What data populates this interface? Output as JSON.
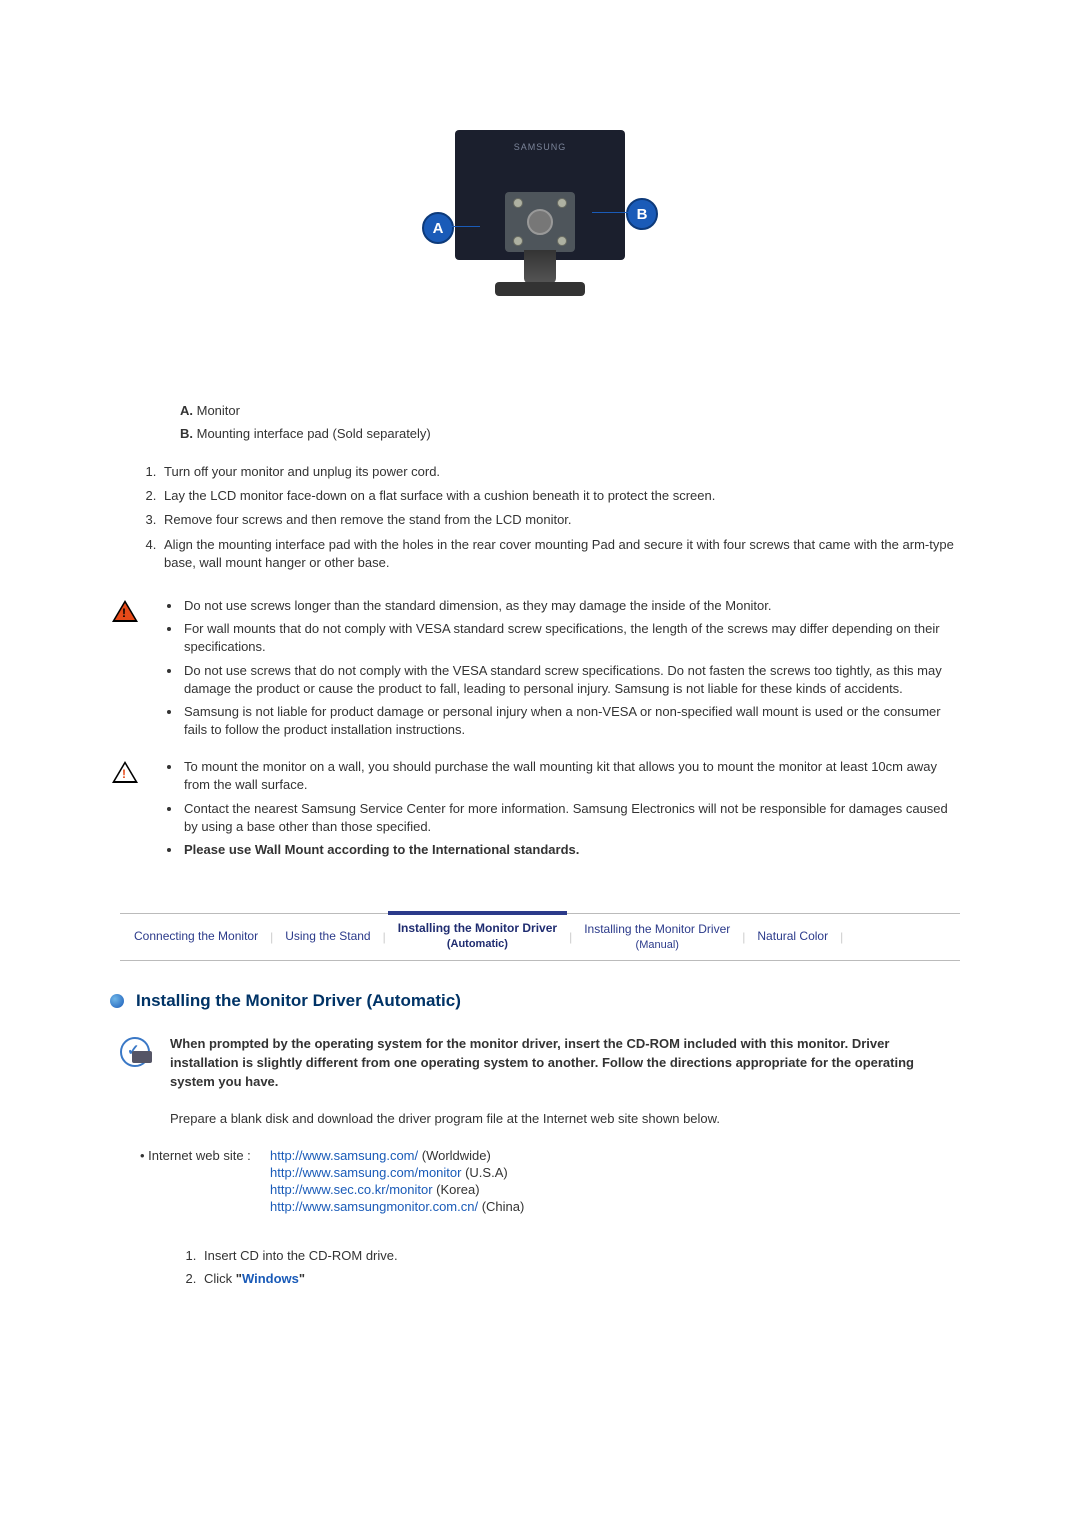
{
  "figure": {
    "markerA": "A",
    "markerB": "B",
    "logo_text": "SAMSUNG"
  },
  "legend": {
    "a_label": "A.",
    "a_text": "Monitor",
    "b_label": "B.",
    "b_text": "Mounting interface pad (Sold separately)"
  },
  "steps": [
    "Turn off your monitor and unplug its power cord.",
    "Lay the LCD monitor face-down on a flat surface with a cushion beneath it to protect the screen.",
    "Remove four screws and then remove the stand from the LCD monitor.",
    "Align the mounting interface pad with the holes in the rear cover mounting Pad and secure it with four screws that came with the arm-type base, wall mount hanger or other base."
  ],
  "warn1": [
    "Do not use screws longer than the standard dimension, as they may damage the inside of the Monitor.",
    "For wall mounts that do not comply with VESA standard screw specifications, the length of the screws may differ depending on their specifications.",
    "Do not use screws that do not comply with the VESA standard screw specifications. Do not fasten the screws too tightly, as this may damage the product or cause the product to fall, leading to personal injury. Samsung is not liable for these kinds of accidents.",
    "Samsung is not liable for product damage or personal injury when a non-VESA or non-specified wall mount is used or the  consumer fails to follow the product installation instructions."
  ],
  "warn2_a": "To mount the monitor on a wall, you should purchase the wall mounting kit that allows you to mount the monitor at least 10cm away from the wall surface.",
  "warn2_b": "Contact the nearest Samsung Service Center for more information. Samsung Electronics will not be responsible for damages caused by using a base other than those specified.",
  "warn2_c": "Please use Wall Mount according to the International standards.",
  "tabs": {
    "t1": "Connecting  the Monitor",
    "t2": "Using the Stand",
    "t3": "Installing the Monitor Driver",
    "t3_sub": "(Automatic)",
    "t4": "Installing the Monitor Driver",
    "t4_sub": "(Manual)",
    "t5": "Natural Color"
  },
  "section_title": "Installing the Monitor Driver (Automatic)",
  "prompt_bold": "When prompted by the operating system for the monitor driver, insert the CD-ROM included with this monitor. Driver installation is slightly different from one operating system to another. Follow the directions appropriate for the operating system you have.",
  "prepare_text": "Prepare a blank disk and download the driver program file at the Internet web site shown below.",
  "site_label": "Internet web site :",
  "sites": [
    {
      "url": "http://www.samsung.com/",
      "region": " (Worldwide)"
    },
    {
      "url": "http://www.samsung.com/monitor",
      "region": " (U.S.A)"
    },
    {
      "url": "http://www.sec.co.kr/monitor",
      "region": " (Korea)"
    },
    {
      "url": "http://www.samsungmonitor.com.cn/",
      "region": " (China)"
    }
  ],
  "drv_steps": {
    "s1": "Insert CD into the CD-ROM drive.",
    "s2_prefix": "Click ",
    "s2_quote_open": "\"",
    "s2_windows": "Windows",
    "s2_quote_close": "\""
  }
}
